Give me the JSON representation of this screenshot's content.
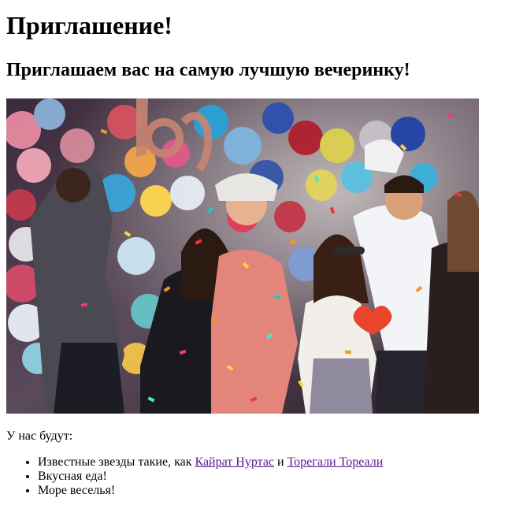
{
  "page": {
    "title": "Приглашение!",
    "subtitle": "Приглашаем вас на самую лучшую вечеринку!",
    "intro": "У нас будут:",
    "list": {
      "item1_prefix": "Известные звезды такие, как ",
      "link1": "Кайрат Нуртас",
      "and": " и ",
      "link2": "Торегали Тореали",
      "item2": "Вкусная еда!",
      "item3": "Море веселья!"
    }
  },
  "colors": {
    "link": "#551a8b"
  }
}
